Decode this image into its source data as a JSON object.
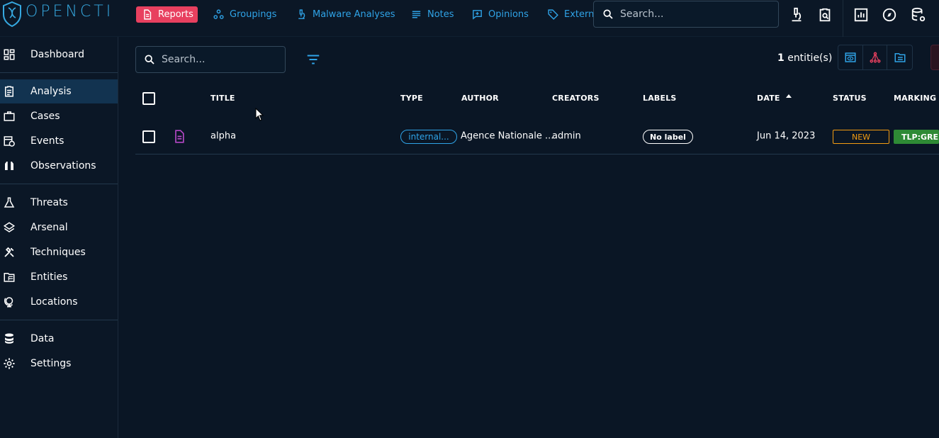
{
  "app": {
    "name": "OPENCTI"
  },
  "topnav": {
    "items": [
      {
        "label": "Reports",
        "icon": "report-icon",
        "active": true
      },
      {
        "label": "Groupings",
        "icon": "groupings-icon"
      },
      {
        "label": "Malware Analyses",
        "icon": "microscope-icon"
      },
      {
        "label": "Notes",
        "icon": "notes-icon"
      },
      {
        "label": "Opinions",
        "icon": "opinion-icon"
      },
      {
        "label": "Extern",
        "icon": "tag-icon"
      }
    ],
    "search_placeholder": "Search...",
    "right_icons": [
      "microscope-icon",
      "clipboard-search-icon",
      "chart-box-icon",
      "compass-icon",
      "database-cog-icon"
    ]
  },
  "sidebar": {
    "items": [
      {
        "label": "Dashboard",
        "icon": "dashboard-icon"
      },
      {
        "label": "Analysis",
        "icon": "clipboard-icon",
        "active": true
      },
      {
        "label": "Cases",
        "icon": "briefcase-icon"
      },
      {
        "label": "Events",
        "icon": "calendar-clock-icon"
      },
      {
        "label": "Observations",
        "icon": "binoculars-icon"
      },
      {
        "label": "Threats",
        "icon": "flask-icon"
      },
      {
        "label": "Arsenal",
        "icon": "layers-icon"
      },
      {
        "label": "Techniques",
        "icon": "tools-icon"
      },
      {
        "label": "Entities",
        "icon": "folder-table-icon"
      },
      {
        "label": "Locations",
        "icon": "globe-icon"
      },
      {
        "label": "Data",
        "icon": "database-icon"
      },
      {
        "label": "Settings",
        "icon": "gear-icon"
      }
    ]
  },
  "toolbar": {
    "search_placeholder": "Search...",
    "count_number": "1",
    "count_label": " entitie(s)"
  },
  "table": {
    "headers": {
      "title": "TITLE",
      "type": "TYPE",
      "author": "AUTHOR",
      "creators": "CREATORS",
      "labels": "LABELS",
      "date": "DATE",
      "status": "STATUS",
      "marking": "MARKING"
    },
    "rows": [
      {
        "title": "alpha",
        "type": "internal...",
        "author": "Agence Nationale ...",
        "creators": "admin",
        "labels": "No label",
        "date": "Jun 14, 2023",
        "status": "NEW",
        "marking": "TLP:GRE..."
      }
    ]
  },
  "colors": {
    "accent": "#2fa3e7",
    "active_nav": "#e8405f",
    "status_new": "#f39c12",
    "marking_green": "#2e8a35",
    "report_icon": "#b548c6"
  }
}
